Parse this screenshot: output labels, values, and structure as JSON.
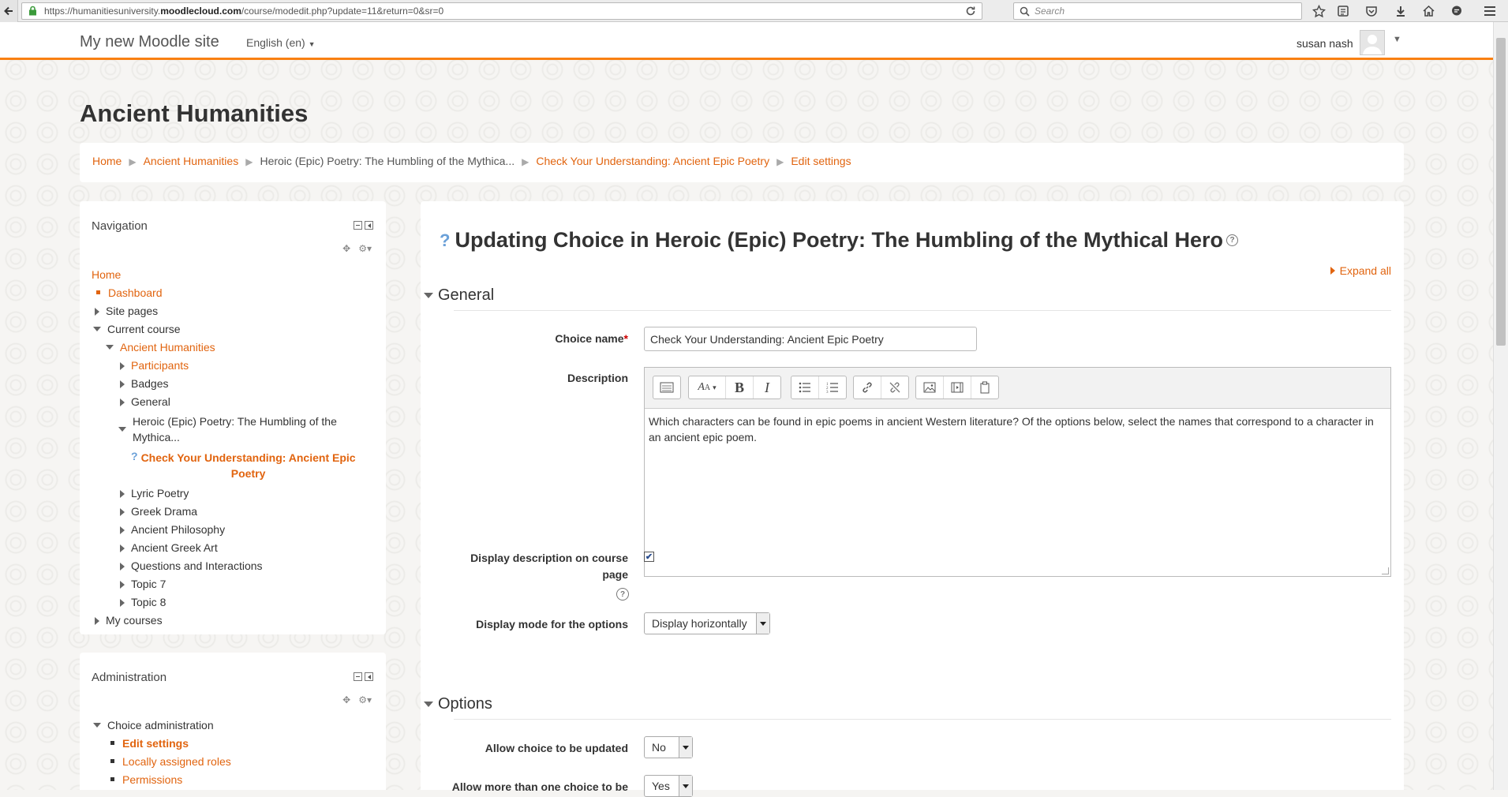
{
  "browser": {
    "url_prefix": "https://humanitiesuniversity.",
    "url_domain": "moodlecloud.com",
    "url_path": "/course/modedit.php?update=11&return=0&sr=0",
    "search_placeholder": "Search"
  },
  "navbar": {
    "site_name": "My new Moodle site",
    "language": "English (en)",
    "user_name": "susan nash"
  },
  "course_title": "Ancient Humanities",
  "breadcrumb": [
    "Home",
    "Ancient Humanities",
    "Heroic (Epic) Poetry: The Humbling of the Mythica...",
    "Check Your Understanding: Ancient Epic Poetry",
    "Edit settings"
  ],
  "navigation_block": {
    "title": "Navigation",
    "home": "Home",
    "dashboard": "Dashboard",
    "site_pages": "Site pages",
    "current_course": "Current course",
    "course": "Ancient Humanities",
    "participants": "Participants",
    "badges": "Badges",
    "general": "General",
    "heroic_line1": "Heroic (Epic) Poetry: The Humbling of the",
    "heroic_line2": "Mythica...",
    "check_line1": "Check Your Understanding: Ancient Epic",
    "check_line2": "Poetry",
    "lyric": "Lyric Poetry",
    "drama": "Greek Drama",
    "philosophy": "Ancient Philosophy",
    "art": "Ancient Greek Art",
    "questions": "Questions and Interactions",
    "topic7": "Topic 7",
    "topic8": "Topic 8",
    "my_courses": "My courses"
  },
  "admin_block": {
    "title": "Administration",
    "choice_admin": "Choice administration",
    "edit_settings": "Edit settings",
    "local_roles": "Locally assigned roles",
    "permissions": "Permissions"
  },
  "main": {
    "heading": "Updating Choice in Heroic (Epic) Poetry: The Humbling of the Mythical Hero",
    "expand_all": "Expand all",
    "general_section": "General",
    "choice_name_label": "Choice name",
    "choice_name_value": "Check Your Understanding: Ancient Epic Poetry",
    "description_label": "Description",
    "description_text": "Which characters can be found in epic poems in ancient Western literature? Of the options below, select the names that correspond to a character in an ancient epic poem.",
    "display_desc_label_line1": "Display description on course",
    "display_desc_label_line2": "page",
    "display_mode_label": "Display mode for the options",
    "display_mode_value": "Display horizontally",
    "options_section": "Options",
    "allow_update_label": "Allow choice to be updated",
    "allow_update_value": "No",
    "allow_more_label": "Allow more than one choice to be",
    "allow_more_value": "Yes"
  }
}
